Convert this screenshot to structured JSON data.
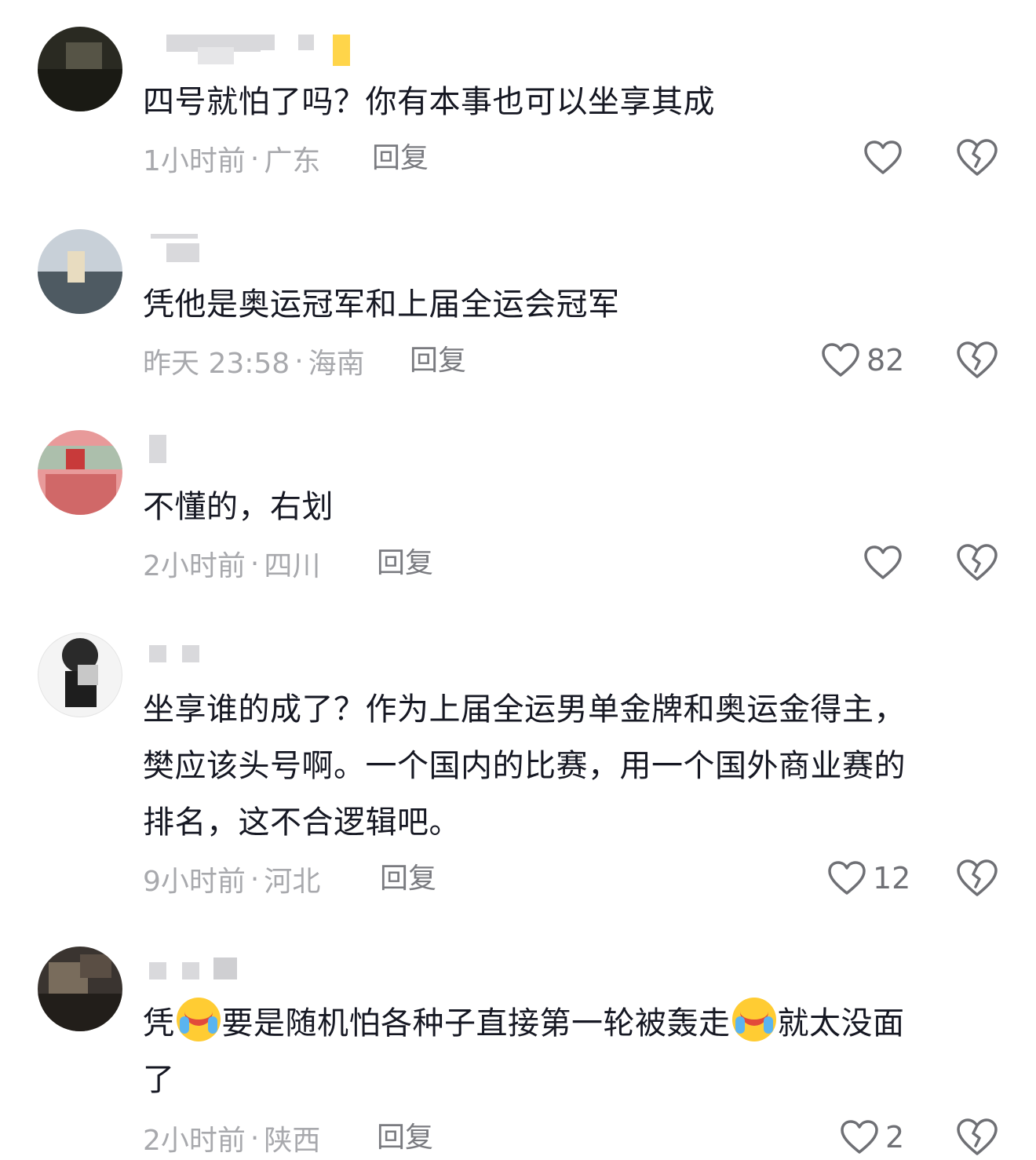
{
  "comments": [
    {
      "text_lines": [
        "四号就怕了吗？你有本事也可以坐享其成"
      ],
      "time": "1小时前",
      "region": "广东",
      "reply_label": "回复",
      "likes": "",
      "avatar_colors": [
        "#2a2a22",
        "#5a5a4a"
      ]
    },
    {
      "text_lines": [
        "凭他是奥运冠军和上届全运会冠军"
      ],
      "time": "昨天 23:58",
      "region": "海南",
      "reply_label": "回复",
      "likes": "82",
      "avatar_colors": [
        "#b8c2cc",
        "#4a5660"
      ]
    },
    {
      "text_lines": [
        "不懂的，右划"
      ],
      "time": "2小时前",
      "region": "四川",
      "reply_label": "回复",
      "likes": "",
      "avatar_colors": [
        "#e88a8a",
        "#b04848"
      ]
    },
    {
      "text_lines": [
        "坐享谁的成了？作为上届全运男单金牌和奥运金得主，",
        "樊应该头号啊。一个国内的比赛，用一个国外商业赛的",
        "排名，这不合逻辑吧。"
      ],
      "time": "9小时前",
      "region": "河北",
      "reply_label": "回复",
      "likes": "12",
      "avatar_colors": [
        "#f2f2f2",
        "#2a2a2a"
      ]
    },
    {
      "text_parts": [
        "凭",
        "要是随机怕各种子直接第一轮被轰走",
        "就太没面"
      ],
      "text_line2": "了",
      "emoji_name": "rofl-emoji",
      "time": "2小时前",
      "region": "陕西",
      "reply_label": "回复",
      "likes": "2",
      "avatar_colors": [
        "#3a3430",
        "#7a6a5a"
      ]
    }
  ],
  "meta_separator": "·",
  "icons": {
    "like": "heart-outline-icon",
    "dislike": "broken-heart-icon"
  },
  "colors": {
    "text": "#161823",
    "meta": "#a8a9ad",
    "reply": "#7a7b80",
    "icon_stroke": "#6f7075"
  }
}
